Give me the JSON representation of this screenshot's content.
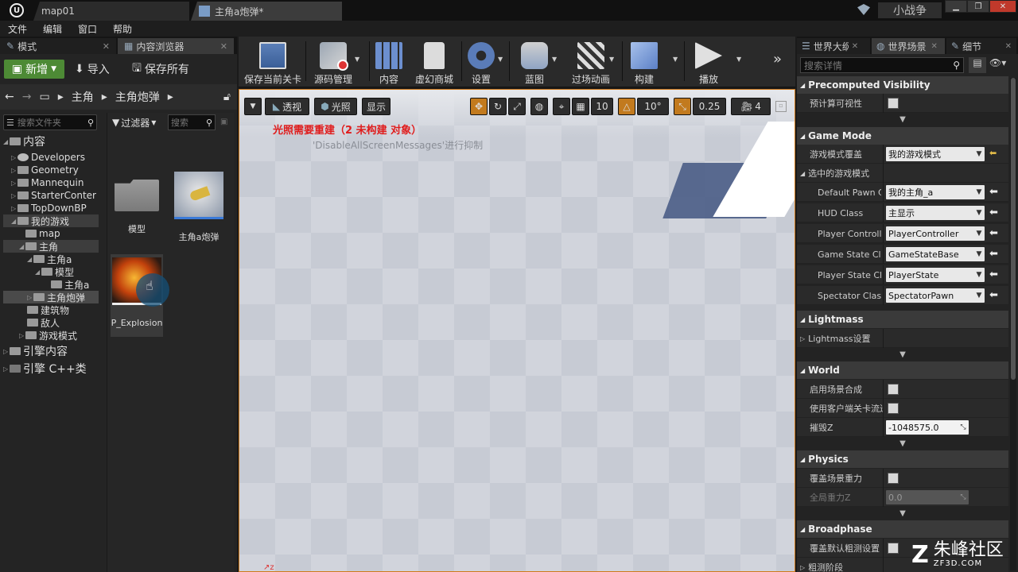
{
  "titlebar": {
    "tabs": [
      {
        "label": "map01"
      },
      {
        "label": "主角a炮弹*"
      }
    ],
    "project_name": "小战争"
  },
  "menu": {
    "items": [
      "文件",
      "编辑",
      "窗口",
      "帮助"
    ]
  },
  "left_panel": {
    "tabs": [
      {
        "label": "模式"
      },
      {
        "label": "内容浏览器"
      }
    ],
    "new_label": "新增",
    "import_label": "导入",
    "save_all_label": "保存所有",
    "path": [
      "主角",
      "主角炮弹"
    ],
    "folder_search_placeholder": "搜索文件夹",
    "tree": [
      {
        "label": "内容"
      },
      {
        "label": "Developers"
      },
      {
        "label": "Geometry"
      },
      {
        "label": "Mannequin"
      },
      {
        "label": "StarterConter"
      },
      {
        "label": "TopDownBP"
      },
      {
        "label": "我的游戏"
      },
      {
        "label": "map"
      },
      {
        "label": "主角"
      },
      {
        "label": "主角a"
      },
      {
        "label": "模型"
      },
      {
        "label": "主角a"
      },
      {
        "label": "主角炮弹"
      },
      {
        "label": "建筑物"
      },
      {
        "label": "敌人"
      },
      {
        "label": "游戏模式"
      },
      {
        "label": "引擎内容"
      },
      {
        "label": "引擎 C++类"
      }
    ],
    "filter_label": "过滤器",
    "asset_search_placeholder": "搜索",
    "assets": [
      {
        "label": "模型"
      },
      {
        "label": "主角a炮弹"
      },
      {
        "label": "P_Explosion"
      }
    ]
  },
  "toolbar": {
    "buttons": [
      {
        "label": "保存当前关卡",
        "icon": "save-icon"
      },
      {
        "label": "源码管理",
        "icon": "source-control-icon"
      },
      {
        "label": "内容",
        "icon": "content-icon"
      },
      {
        "label": "虚幻商城",
        "icon": "marketplace-icon"
      },
      {
        "label": "设置",
        "icon": "settings-icon"
      },
      {
        "label": "蓝图",
        "icon": "blueprint-icon"
      },
      {
        "label": "过场动画",
        "icon": "cinematics-icon"
      },
      {
        "label": "构建",
        "icon": "build-icon"
      },
      {
        "label": "播放",
        "icon": "play-icon"
      }
    ]
  },
  "viewport": {
    "perspective_label": "透视",
    "lit_label": "光照",
    "show_label": "显示",
    "grid_snap": "10",
    "rotation_snap": "10°",
    "scale_snap": "0.25",
    "camera_speed": "4",
    "warning": "光照需要重建（2 未构建 对象）",
    "note": "'DisableAllScreenMessages'进行抑制"
  },
  "right_panel": {
    "tabs": [
      {
        "label": "世界大纲"
      },
      {
        "label": "世界场景"
      },
      {
        "label": "细节"
      }
    ],
    "search_placeholder": "搜索详情",
    "sections": {
      "precomputed": {
        "title": "Precomputed Visibility",
        "prop_label": "预计算可视性"
      },
      "game_mode": {
        "title": "Game Mode",
        "override_label": "游戏模式覆盖",
        "override_value": "我的游戏模式",
        "selected_label": "选中的游戏模式",
        "props": [
          {
            "label": "Default Pawn Class",
            "value": "我的主角_a"
          },
          {
            "label": "HUD Class",
            "value": "主显示"
          },
          {
            "label": "Player Controller Class",
            "value": "PlayerController"
          },
          {
            "label": "Game State Class",
            "value": "GameStateBase"
          },
          {
            "label": "Player State Class",
            "value": "PlayerState"
          },
          {
            "label": "Spectator Class",
            "value": "SpectatorPawn"
          }
        ]
      },
      "lightmass": {
        "title": "Lightmass",
        "prop_label": "Lightmass设置"
      },
      "world": {
        "title": "World",
        "props": [
          {
            "label": "启用场景合成"
          },
          {
            "label": "使用客户端关卡流送"
          },
          {
            "label": "摧毁Z",
            "value": "-1048575.0"
          }
        ]
      },
      "physics": {
        "title": "Physics",
        "props": [
          {
            "label": "覆盖场景重力"
          },
          {
            "label": "全局重力Z",
            "value": "0.0"
          }
        ]
      },
      "broadphase": {
        "title": "Broadphase",
        "props": [
          {
            "label": "覆盖默认粗测设置"
          },
          {
            "label": "粗测阶段"
          }
        ]
      }
    }
  },
  "watermark": {
    "brand": "朱峰社区",
    "site": "ZF3D.COM"
  }
}
